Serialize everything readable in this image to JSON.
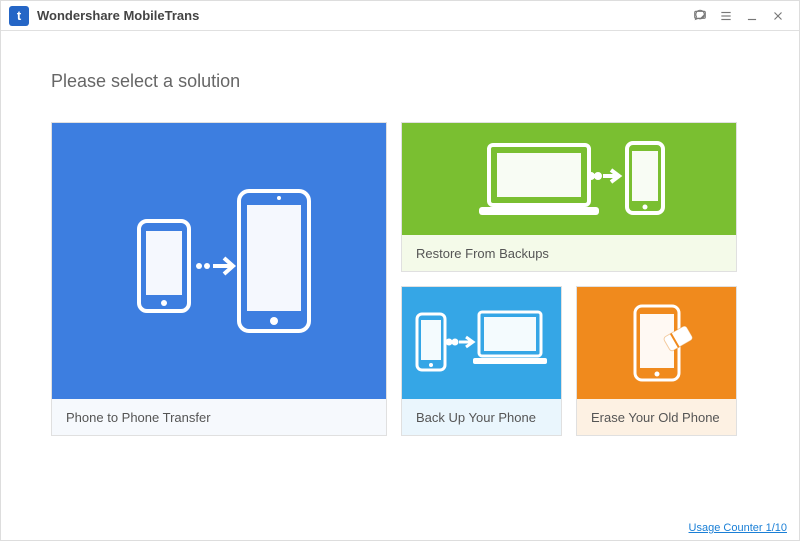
{
  "titlebar": {
    "app_name": "Wondershare MobileTrans",
    "logo_letter": "t"
  },
  "heading": "Please select a solution",
  "cards": {
    "phone_to_phone": {
      "label": "Phone to Phone Transfer",
      "color": "#3d7ee0"
    },
    "restore": {
      "label": "Restore From Backups",
      "color": "#7abf31"
    },
    "backup": {
      "label": "Back Up Your Phone",
      "color": "#35a6e6"
    },
    "erase": {
      "label": "Erase Your Old Phone",
      "color": "#f08a1d"
    }
  },
  "footer": {
    "usage_counter": "Usage Counter 1/10"
  }
}
